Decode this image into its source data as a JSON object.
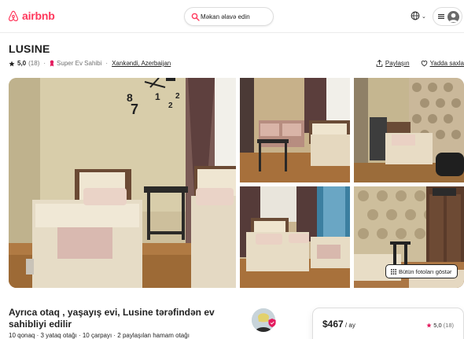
{
  "brand": {
    "name": "airbnb",
    "color": "#ff385c"
  },
  "header": {
    "search_placeholder": "Məkan əlavə edin",
    "globe_caret": "⌄"
  },
  "listing": {
    "title": "LUSINE",
    "rating": "5,0",
    "reviews": "(18)",
    "superhost": "Super Ev Sahibi",
    "location": "Xankəndi, Azerbaijan",
    "separator": "·",
    "share_label": "Paylaşın",
    "save_label": "Yadda saxla"
  },
  "photos": {
    "show_all_label": "Bütün fotoları göstər",
    "items": [
      "bedroom-twin-beds",
      "bedroom-sofa",
      "bedroom-fridge",
      "bedroom-window",
      "bedroom-wardrobe"
    ]
  },
  "summary": {
    "headline": "Ayrıca otaq , yaşayış evi, Lusine tərəfindən ev sahibliyi edilir",
    "details": "10 qonaq · 3 yataq otağı · 10  çarpayı · 2 paylaşılan hamam otağı"
  },
  "booking": {
    "price": "$467",
    "per": " / ay",
    "rating": "5,0",
    "reviews": "(18)"
  },
  "icons": {
    "logo": "airbnb-logo-icon",
    "search": "search-icon",
    "globe": "globe-icon",
    "menu": "menu-icon",
    "star": "star-icon",
    "superhost": "superhost-icon",
    "share": "share-icon",
    "heart": "heart-icon",
    "grid": "grid-icon"
  }
}
